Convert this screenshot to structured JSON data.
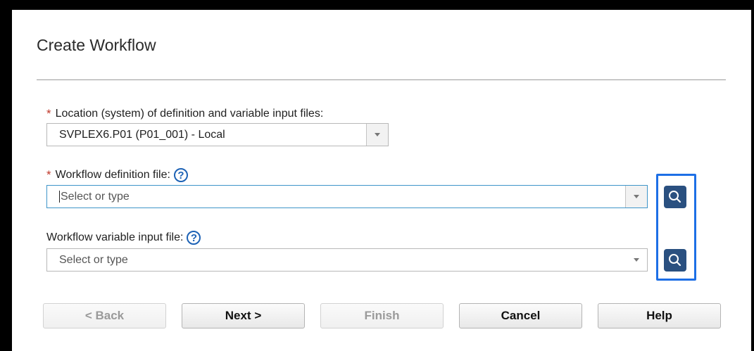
{
  "dialog": {
    "title": "Create Workflow"
  },
  "location": {
    "required_mark": "*",
    "label": "Location (system) of definition and variable input files:",
    "value": "SVPLEX6.P01 (P01_001) - Local"
  },
  "definition_file": {
    "required_mark": "*",
    "label": "Workflow definition file:",
    "placeholder": "Select or type",
    "help_glyph": "?"
  },
  "variable_file": {
    "label": "Workflow variable input file:",
    "placeholder": "Select or type",
    "help_glyph": "?"
  },
  "buttons": {
    "back": "< Back",
    "next": "Next >",
    "finish": "Finish",
    "cancel": "Cancel",
    "help": "Help"
  },
  "colors": {
    "accent_search": "#2a5080",
    "highlight_box": "#1d6fe6",
    "focus_border": "#3e95c9",
    "required": "#c0392b"
  }
}
